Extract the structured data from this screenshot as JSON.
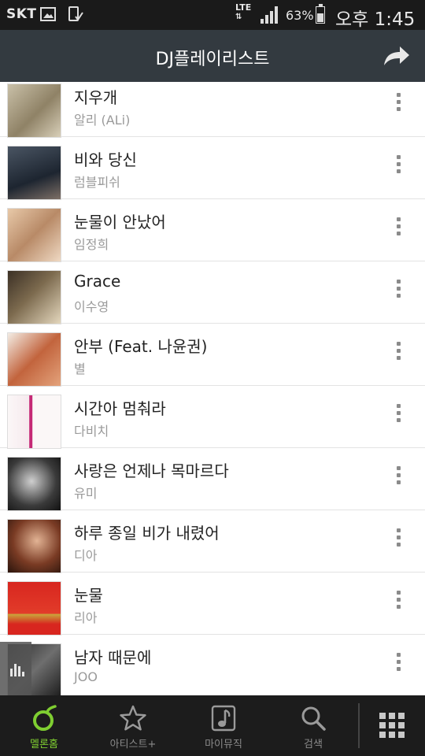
{
  "status_bar": {
    "carrier": "SKT",
    "network": "LTE",
    "battery": "63%",
    "battery_level": 0.63,
    "time": "오후 1:45"
  },
  "header": {
    "title": "DJ플레이리스트"
  },
  "songs": [
    {
      "title": "지우개",
      "artist": "알리 (ALi)"
    },
    {
      "title": "비와 당신",
      "artist": "럼블피쉬"
    },
    {
      "title": "눈물이 안났어",
      "artist": "임정희"
    },
    {
      "title": "Grace",
      "artist": "이수영"
    },
    {
      "title": "안부 (Feat. 나윤권)",
      "artist": "별"
    },
    {
      "title": "시간아 멈춰라",
      "artist": "다비치"
    },
    {
      "title": "사랑은 언제나 목마르다",
      "artist": "유미"
    },
    {
      "title": "하루 종일 비가 내렸어",
      "artist": "디아"
    },
    {
      "title": "눈물",
      "artist": "리아"
    },
    {
      "title": "남자 때문에",
      "artist": "JOO"
    }
  ],
  "bottom_nav": {
    "home": "멜론홈",
    "artist_plus": "아티스트+",
    "my_music": "마이뮤직",
    "search": "검색"
  },
  "colors": {
    "accent": "#7fce31",
    "header_bg": "#333a40",
    "nav_bg": "#1c1c1c"
  }
}
